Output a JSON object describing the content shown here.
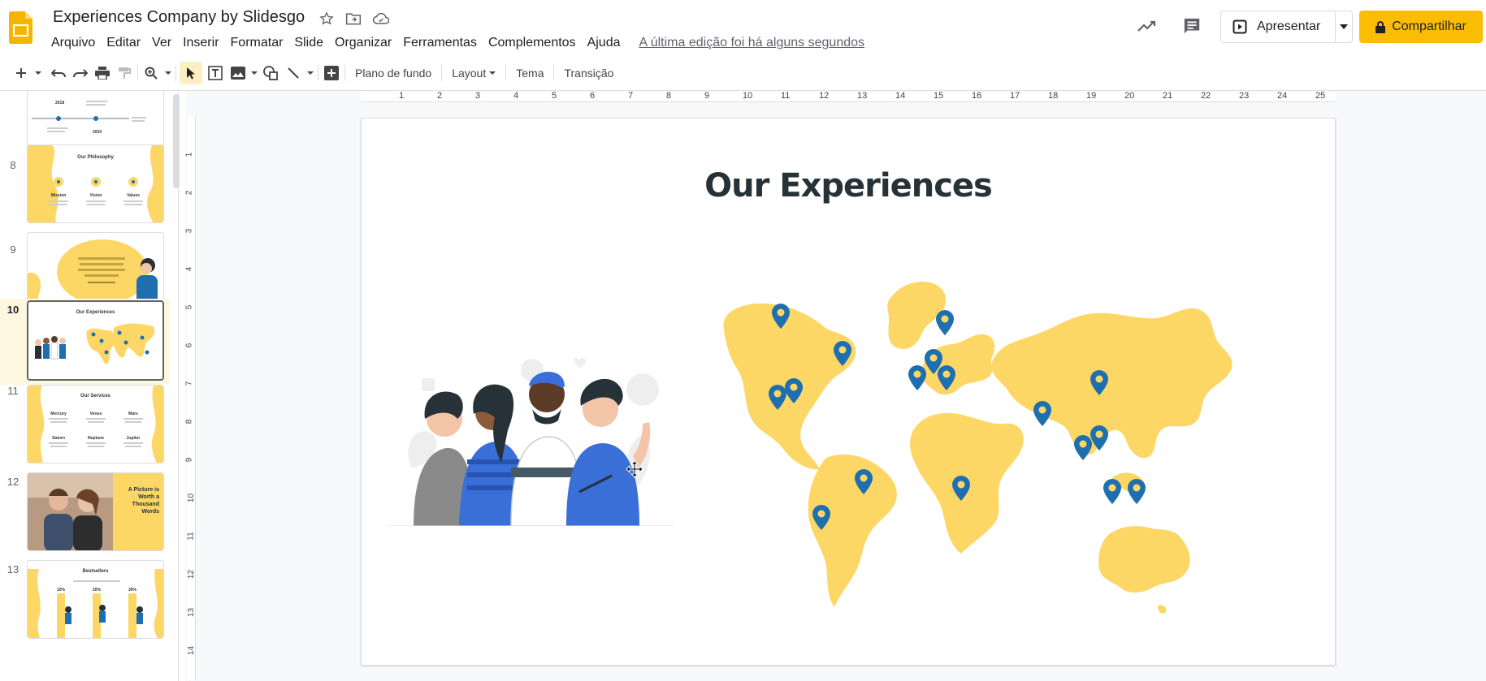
{
  "app": {
    "doc_title": "Experiences Company by Slidesgo",
    "last_edit": "A última edição foi há alguns segundos",
    "brand_color": "#fbbc04"
  },
  "menu": [
    "Arquivo",
    "Editar",
    "Ver",
    "Inserir",
    "Formatar",
    "Slide",
    "Organizar",
    "Ferramentas",
    "Complementos",
    "Ajuda"
  ],
  "header_buttons": {
    "present_label": "Apresentar",
    "share_label": "Compartilhar"
  },
  "toolbar": {
    "background_label": "Plano de fundo",
    "layout_label": "Layout",
    "theme_label": "Tema",
    "transition_label": "Transição"
  },
  "filmstrip": {
    "slides": [
      {
        "num": "8",
        "title": "Our Philosophy"
      },
      {
        "num": "9",
        "title": ""
      },
      {
        "num": "10",
        "title": "Our Experiences",
        "selected": true
      },
      {
        "num": "11",
        "title": "Our Services"
      },
      {
        "num": "12",
        "title": "A Picture is Worth a Thousand Words"
      },
      {
        "num": "13",
        "title": "Bestsellers"
      }
    ],
    "partial_slide_labels": [
      "2018",
      "2020"
    ],
    "philosophy_items": [
      "Mission",
      "Vision",
      "Values"
    ],
    "services_items": [
      "Mercury",
      "Venus",
      "Mars",
      "Saturn",
      "Neptune",
      "Jupiter"
    ],
    "picture_title_lines": [
      "A Picture is",
      "Worth a",
      "Thousand",
      "Words"
    ],
    "bestsellers_percentages": [
      "10%",
      "20%",
      "30%"
    ]
  },
  "ruler": {
    "top": [
      "1",
      "2",
      "3",
      "4",
      "5",
      "6",
      "7",
      "8",
      "9",
      "10",
      "11",
      "12",
      "13",
      "14",
      "15",
      "16",
      "17",
      "18",
      "19",
      "20",
      "21",
      "22",
      "23",
      "24",
      "25"
    ],
    "left": [
      "1",
      "2",
      "3",
      "4",
      "5",
      "6",
      "7",
      "8",
      "9",
      "10",
      "11",
      "12",
      "13",
      "14"
    ]
  },
  "slide": {
    "title": "Our Experiences",
    "map_color": "#fdd765",
    "pin_color": "#1e6fb0"
  }
}
